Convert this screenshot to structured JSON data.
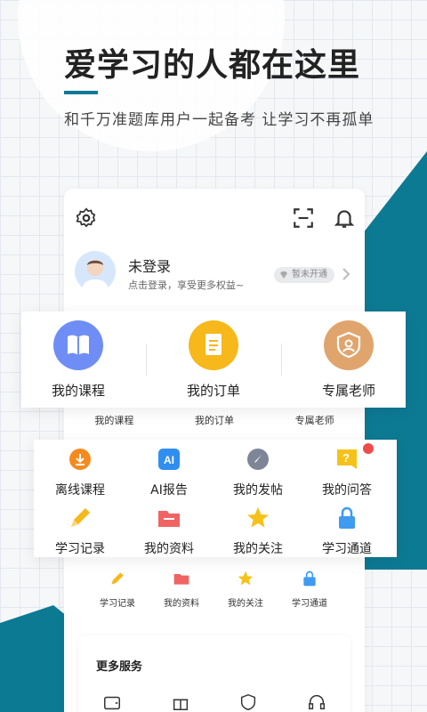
{
  "promo": {
    "headline": "爱学习的人都在这里",
    "subline": "和千万准题库用户一起备考 让学习不再孤单"
  },
  "profile": {
    "name": "未登录",
    "hint": "点击登录，享受更多权益~",
    "vip_badge": "暂未开通"
  },
  "top_icons": [
    "settings-icon",
    "scan-icon",
    "bell-icon"
  ],
  "main_items": [
    {
      "label": "我的课程",
      "icon": "book-icon",
      "color": "#6f8ef5"
    },
    {
      "label": "我的订单",
      "icon": "order-icon",
      "color": "#f6b81a"
    },
    {
      "label": "专属老师",
      "icon": "teacher-icon",
      "color": "#e0a56d"
    }
  ],
  "main_items_small": [
    "我的课程",
    "我的订单",
    "专属老师"
  ],
  "grid_items": [
    {
      "label": "离线课程",
      "icon": "download-icon"
    },
    {
      "label": "AI报告",
      "icon": "ai-icon"
    },
    {
      "label": "我的发帖",
      "icon": "post-icon"
    },
    {
      "label": "我的问答",
      "icon": "qa-icon"
    },
    {
      "label": "学习记录",
      "icon": "pencil-icon"
    },
    {
      "label": "我的资料",
      "icon": "folder-icon"
    },
    {
      "label": "我的关注",
      "icon": "star-icon"
    },
    {
      "label": "学习通道",
      "icon": "lock-icon"
    }
  ],
  "mini_items": [
    "学习记录",
    "我的资料",
    "我的关注",
    "学习通道"
  ],
  "more_services": {
    "title": "更多服务",
    "icons": [
      "wallet-icon",
      "gift-icon",
      "shield-icon",
      "headset-icon"
    ]
  },
  "colors": {
    "accent": "#0d7a93",
    "red_dot": "#ee4b4b"
  }
}
